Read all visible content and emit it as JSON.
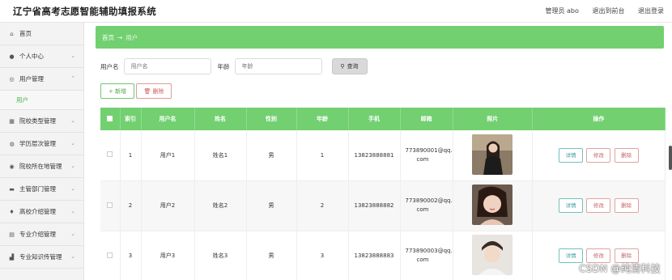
{
  "header": {
    "title": "辽宁省高考志愿智能辅助填报系统",
    "admin": "管理员 abo",
    "back": "退出到前台",
    "logout": "退出登录"
  },
  "sidebar": {
    "items": [
      {
        "label": "首页",
        "icon": "home-icon"
      },
      {
        "label": "个人中心",
        "icon": "user-icon"
      },
      {
        "label": "用户管理",
        "icon": "user-circle-icon"
      },
      {
        "label": "院校类型管理",
        "icon": "grid-icon"
      },
      {
        "label": "学历层次管理",
        "icon": "globe-icon"
      },
      {
        "label": "院校所在地管理",
        "icon": "location-icon"
      },
      {
        "label": "主管部门管理",
        "icon": "chat-icon"
      },
      {
        "label": "高校介绍管理",
        "icon": "pin-icon"
      },
      {
        "label": "专业介绍管理",
        "icon": "doc-icon"
      },
      {
        "label": "专业知识传管理",
        "icon": "chart-icon"
      }
    ],
    "sub_item": "用户"
  },
  "breadcrumb": {
    "home": "首页",
    "arrow": "→",
    "current": "用户"
  },
  "search": {
    "username_label": "用户名",
    "username_placeholder": "用户名",
    "age_label": "年龄",
    "age_placeholder": "年龄",
    "button": "查询"
  },
  "actions": {
    "add": "+ 新增",
    "delete": "删除"
  },
  "table": {
    "headers": [
      "索引",
      "用户名",
      "姓名",
      "性别",
      "年龄",
      "手机",
      "邮箱",
      "照片",
      "操作"
    ],
    "rows": [
      {
        "index": "1",
        "username": "用户1",
        "name": "姓名1",
        "gender": "男",
        "age": "1",
        "phone": "13823888881",
        "email_a": "773890001@qq.",
        "email_b": "com"
      },
      {
        "index": "2",
        "username": "用户2",
        "name": "姓名2",
        "gender": "男",
        "age": "2",
        "phone": "13823888882",
        "email_a": "773890002@qq.",
        "email_b": "com"
      },
      {
        "index": "3",
        "username": "用户3",
        "name": "姓名3",
        "gender": "男",
        "age": "3",
        "phone": "13823888883",
        "email_a": "773890003@qq.",
        "email_b": "com"
      }
    ],
    "op_detail": "详情",
    "op_edit": "修改",
    "op_delete": "删除"
  },
  "watermark": "CSDN @纯清科技",
  "colors": {
    "accent": "#72d070",
    "sidebar_bg": "#f3f3f3"
  }
}
